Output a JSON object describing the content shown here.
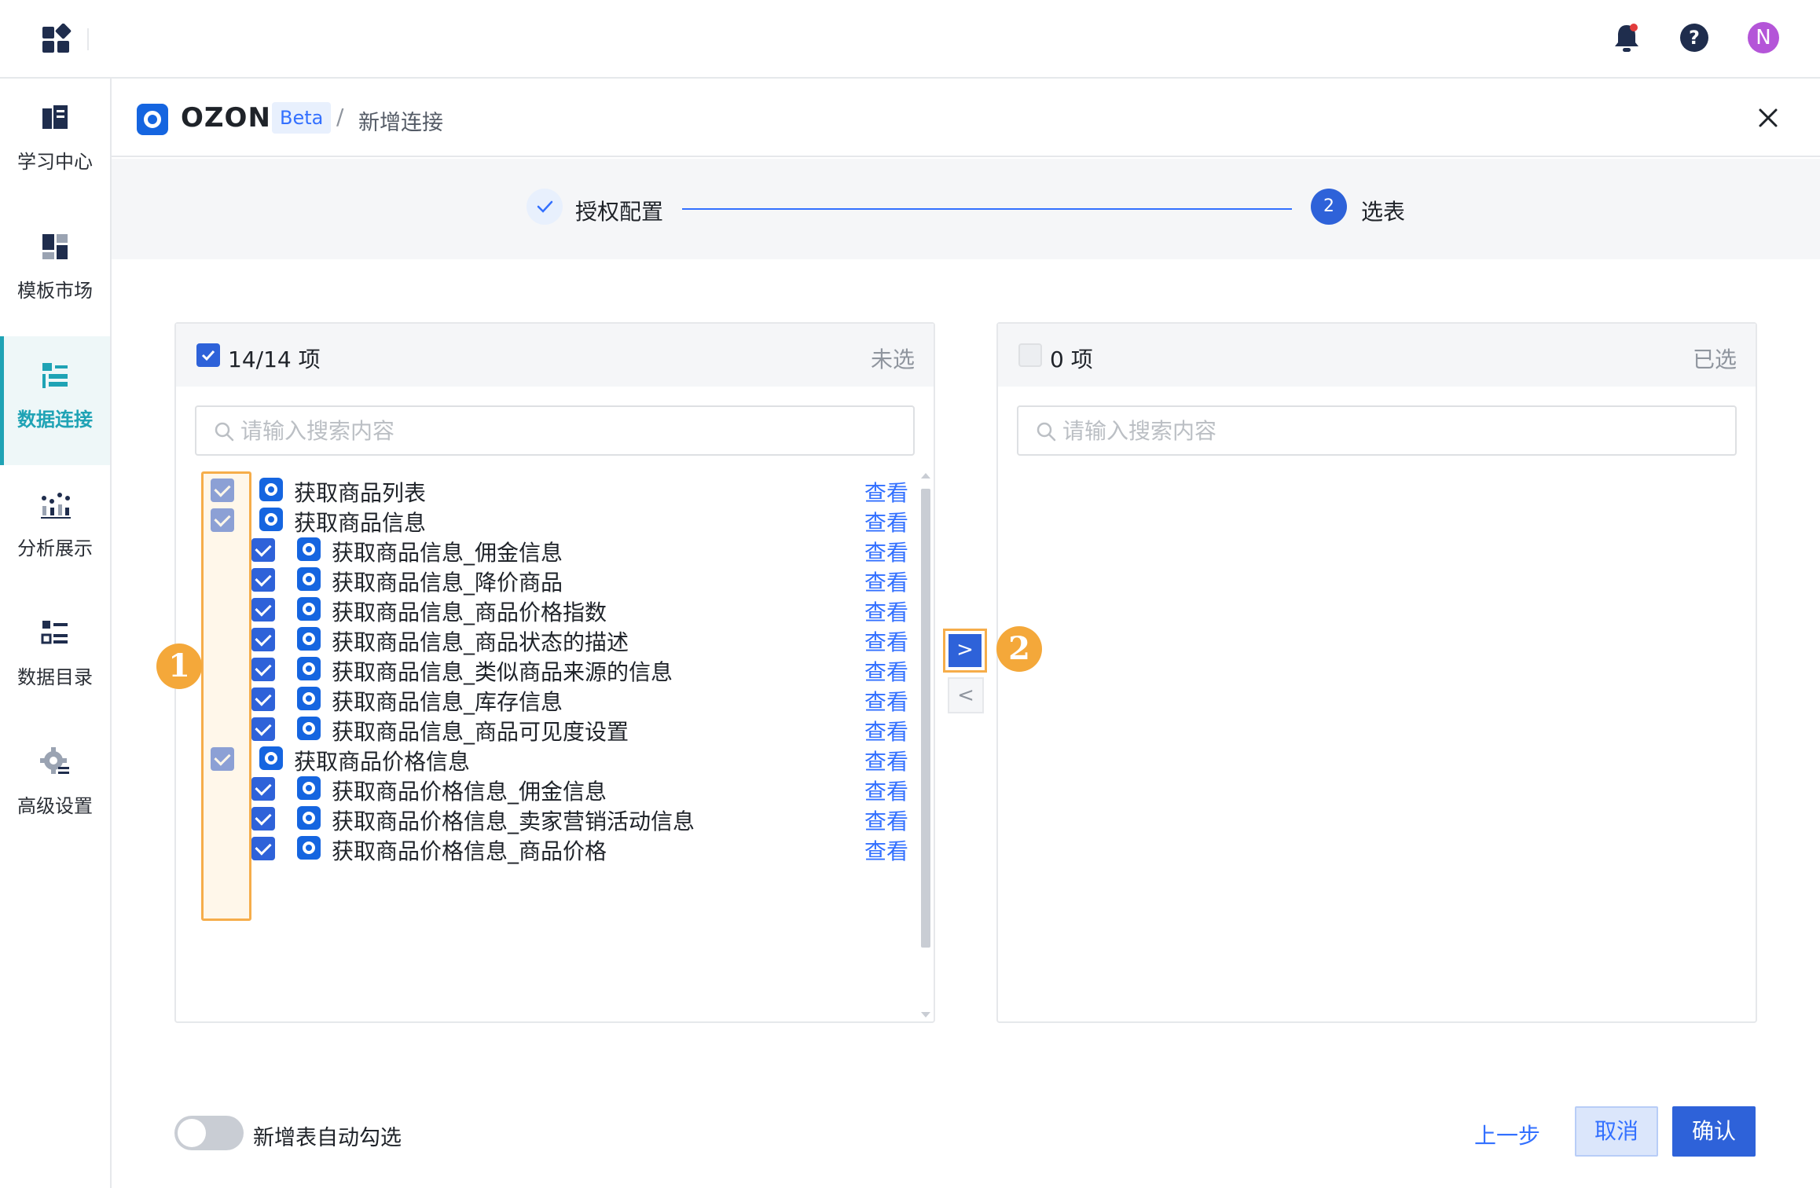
{
  "topbar": {
    "avatar_initial": "N"
  },
  "sidebar": {
    "items": [
      {
        "label": "学习中心"
      },
      {
        "label": "模板市场"
      },
      {
        "label": "数据连接"
      },
      {
        "label": "分析展示"
      },
      {
        "label": "数据目录"
      },
      {
        "label": "高级设置"
      }
    ]
  },
  "header": {
    "brand": "OZON",
    "badge": "Beta",
    "separator": "/",
    "page": "新增连接"
  },
  "steps": {
    "step1_label": "授权配置",
    "step2_number": "2",
    "step2_label": "选表"
  },
  "left_panel": {
    "count": "14/14 项",
    "side_label": "未选",
    "search_placeholder": "请输入搜索内容",
    "view_label": "查看",
    "rows": [
      {
        "name": "获取商品列表"
      },
      {
        "name": "获取商品信息"
      },
      {
        "name": "获取商品信息_佣金信息"
      },
      {
        "name": "获取商品信息_降价商品"
      },
      {
        "name": "获取商品信息_商品价格指数"
      },
      {
        "name": "获取商品信息_商品状态的描述"
      },
      {
        "name": "获取商品信息_类似商品来源的信息"
      },
      {
        "name": "获取商品信息_库存信息"
      },
      {
        "name": "获取商品信息_商品可见度设置"
      },
      {
        "name": "获取商品价格信息"
      },
      {
        "name": "获取商品价格信息_佣金信息"
      },
      {
        "name": "获取商品价格信息_卖家营销活动信息"
      },
      {
        "name": "获取商品价格信息_商品价格"
      }
    ]
  },
  "right_panel": {
    "count": "0 项",
    "side_label": "已选",
    "search_placeholder": "请输入搜索内容"
  },
  "transfer": {
    "right_arrow": ">",
    "left_arrow": "<"
  },
  "annotations": {
    "badge1": "1",
    "badge2": "2"
  },
  "footer": {
    "toggle_label": "新增表自动勾选",
    "prev_label": "上一步",
    "cancel_label": "取消",
    "confirm_label": "确认"
  },
  "colors": {
    "primary": "#2e62d9",
    "link": "#3370ff",
    "accent_teal": "#1fa3b5",
    "annotation": "#f4a83a",
    "ozon_blue": "#1565e0"
  }
}
